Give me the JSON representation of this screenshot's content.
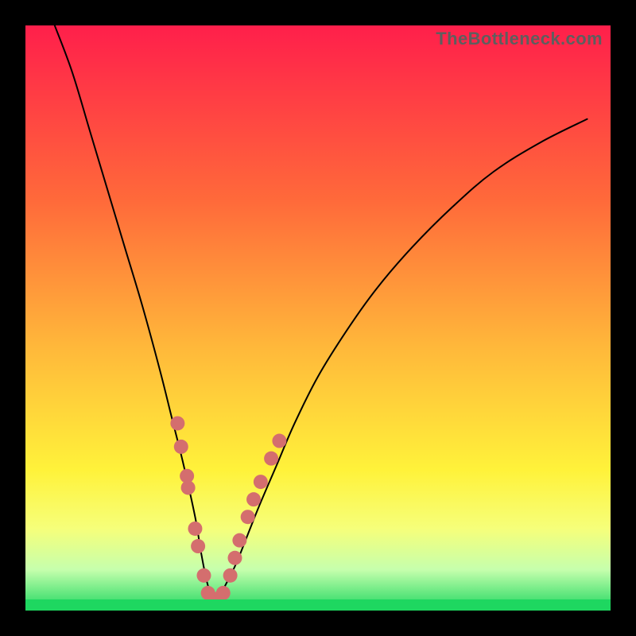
{
  "watermark": "TheBottleneck.com",
  "colors": {
    "gradient": [
      "#ff1f4b",
      "#ff6a3a",
      "#ffb83a",
      "#fff23a",
      "#f6ff7a",
      "#c6ffad",
      "#1ed760"
    ],
    "curve": "#000000",
    "marker": "#d46e6e",
    "frame": "#000000"
  },
  "chart_data": {
    "type": "line",
    "title": "",
    "xlabel": "",
    "ylabel": "",
    "xlim": [
      0,
      100
    ],
    "ylim": [
      0,
      100
    ],
    "valley_x": 32,
    "series": [
      {
        "name": "bottleneck-curve",
        "x": [
          5,
          8,
          11,
          14,
          17,
          20,
          23,
          25,
          27,
          29,
          30,
          31,
          32,
          33,
          34,
          36,
          38,
          40,
          43,
          46,
          50,
          55,
          60,
          66,
          73,
          80,
          88,
          96
        ],
        "y": [
          100,
          92,
          82,
          72,
          62,
          52,
          41,
          33,
          25,
          16,
          10,
          5,
          2,
          2,
          4,
          8,
          13,
          18,
          25,
          32,
          40,
          48,
          55,
          62,
          69,
          75,
          80,
          84
        ]
      }
    ],
    "markers": {
      "name": "highlighted-points",
      "color": "#d46e6e",
      "points": [
        {
          "x": 26.0,
          "y": 32
        },
        {
          "x": 26.6,
          "y": 28
        },
        {
          "x": 27.6,
          "y": 23
        },
        {
          "x": 27.8,
          "y": 21
        },
        {
          "x": 29.0,
          "y": 14
        },
        {
          "x": 29.5,
          "y": 11
        },
        {
          "x": 30.5,
          "y": 6
        },
        {
          "x": 31.2,
          "y": 3
        },
        {
          "x": 32.0,
          "y": 2
        },
        {
          "x": 32.8,
          "y": 2
        },
        {
          "x": 33.8,
          "y": 3
        },
        {
          "x": 35.0,
          "y": 6
        },
        {
          "x": 35.8,
          "y": 9
        },
        {
          "x": 36.6,
          "y": 12
        },
        {
          "x": 38.0,
          "y": 16
        },
        {
          "x": 39.0,
          "y": 19
        },
        {
          "x": 40.2,
          "y": 22
        },
        {
          "x": 42.0,
          "y": 26
        },
        {
          "x": 43.4,
          "y": 29
        }
      ]
    }
  }
}
